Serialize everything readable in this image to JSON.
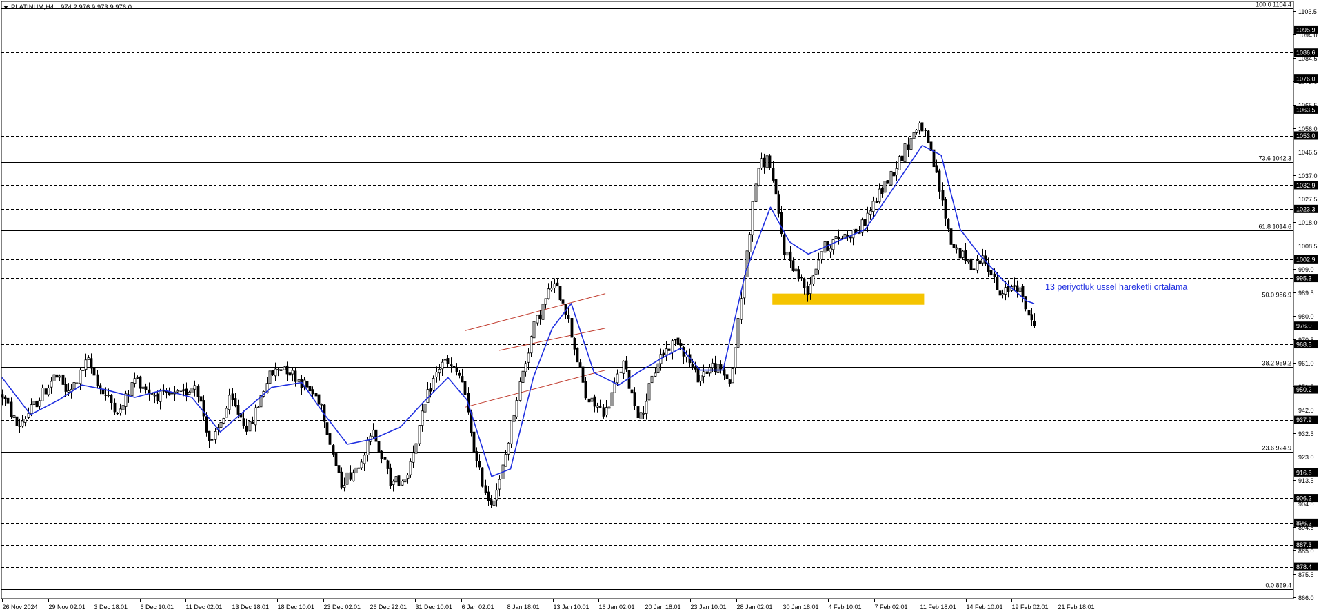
{
  "header": {
    "symbol_timeframe": "PLATINUM,H4",
    "ohlc": "974.2 976.9 973.9 976.0"
  },
  "annotation": {
    "ema_label": "13 periyotluk üssel hareketli ortalama"
  },
  "colors": {
    "background": "#ffffff",
    "candle": "#000000",
    "ema": "#1f2fe0",
    "channel": "#c0392b",
    "highlight": "#f5c400",
    "label_box": "#000000",
    "label_text": "#ffffff",
    "annotation_text": "#1f2fe0"
  },
  "chart_data": {
    "type": "candlestick",
    "title": "PLATINUM,H4",
    "ylim": [
      866.0,
      1107.0
    ],
    "yticks": [
      "1103.5",
      "1094.0",
      "1084.5",
      "1075.0",
      "1065.5",
      "1056.0",
      "1046.5",
      "1037.0",
      "1027.5",
      "1018.0",
      "1008.5",
      "999.0",
      "989.5",
      "980.0",
      "970.5",
      "961.0",
      "951.5",
      "942.0",
      "932.5",
      "923.0",
      "913.5",
      "904.0",
      "894.5",
      "885.0",
      "875.5",
      "866.0"
    ],
    "xticks": [
      "26 Nov 2024",
      "29 Nov 02:01",
      "3 Dec 18:01",
      "6 Dec 10:01",
      "11 Dec 02:01",
      "13 Dec 18:01",
      "18 Dec 10:01",
      "23 Dec 02:01",
      "26 Dec 22:01",
      "31 Dec 10:01",
      "6 Jan 02:01",
      "8 Jan 18:01",
      "13 Jan 10:01",
      "16 Jan 02:01",
      "20 Jan 18:01",
      "23 Jan 10:01",
      "28 Jan 02:01",
      "30 Jan 18:01",
      "4 Feb 10:01",
      "7 Feb 02:01",
      "11 Feb 18:01",
      "14 Feb 10:01",
      "19 Feb 02:01",
      "21 Feb 18:01"
    ],
    "n_bars": 360,
    "last_price": "976.0",
    "fib_levels": [
      {
        "label": "100.0 1104.4",
        "value": 1104.4
      },
      {
        "label": "73.6 1042.3",
        "value": 1042.3
      },
      {
        "label": "61.8 1014.6",
        "value": 1014.6
      },
      {
        "label": "50.0 986.9",
        "value": 986.9
      },
      {
        "label": "38.2 959.2",
        "value": 959.2
      },
      {
        "label": "23.6 924.9",
        "value": 924.9
      },
      {
        "label": "0.0 869.4",
        "value": 869.4
      }
    ],
    "dashed_levels": [
      {
        "label": "1095.9",
        "value": 1095.9
      },
      {
        "label": "1086.6",
        "value": 1086.6
      },
      {
        "label": "1076.0",
        "value": 1076.0
      },
      {
        "label": "1063.5",
        "value": 1063.5
      },
      {
        "label": "1053.0",
        "value": 1053.0
      },
      {
        "label": "1032.9",
        "value": 1032.9
      },
      {
        "label": "1023.3",
        "value": 1023.3
      },
      {
        "label": "1002.9",
        "value": 1002.9
      },
      {
        "label": "995.3",
        "value": 995.3
      },
      {
        "label": "968.5",
        "value": 968.5
      },
      {
        "label": "950.2",
        "value": 950.2
      },
      {
        "label": "937.9",
        "value": 937.9
      },
      {
        "label": "916.6",
        "value": 916.6
      },
      {
        "label": "906.2",
        "value": 906.2
      },
      {
        "label": "896.2",
        "value": 896.2
      },
      {
        "label": "887.3",
        "value": 887.3
      },
      {
        "label": "878.4",
        "value": 878.4
      }
    ],
    "price_path": [
      [
        0,
        948
      ],
      [
        8,
        935
      ],
      [
        18,
        945
      ],
      [
        28,
        956
      ],
      [
        35,
        948
      ],
      [
        45,
        962
      ],
      [
        52,
        950
      ],
      [
        62,
        941
      ],
      [
        70,
        955
      ],
      [
        78,
        949
      ],
      [
        85,
        947
      ],
      [
        95,
        948
      ],
      [
        102,
        953
      ],
      [
        110,
        927
      ],
      [
        120,
        946
      ],
      [
        130,
        934
      ],
      [
        140,
        955
      ],
      [
        148,
        960
      ],
      [
        158,
        953
      ],
      [
        168,
        945
      ],
      [
        178,
        912
      ],
      [
        186,
        918
      ],
      [
        196,
        933
      ],
      [
        205,
        912
      ],
      [
        213,
        915
      ],
      [
        225,
        950
      ],
      [
        232,
        962
      ],
      [
        242,
        955
      ],
      [
        250,
        920
      ],
      [
        257,
        904
      ],
      [
        262,
        912
      ],
      [
        272,
        950
      ],
      [
        280,
        975
      ],
      [
        290,
        993
      ],
      [
        296,
        986
      ],
      [
        308,
        946
      ],
      [
        318,
        941
      ],
      [
        327,
        961
      ],
      [
        336,
        938
      ],
      [
        346,
        963
      ],
      [
        356,
        971
      ],
      [
        366,
        955
      ],
      [
        375,
        960
      ],
      [
        384,
        953
      ],
      [
        398,
        1040
      ],
      [
        404,
        1044
      ],
      [
        412,
        1007
      ],
      [
        424,
        990
      ],
      [
        432,
        1007
      ],
      [
        442,
        1012
      ],
      [
        452,
        1015
      ],
      [
        462,
        1029
      ],
      [
        472,
        1042
      ],
      [
        484,
        1059
      ],
      [
        492,
        1038
      ],
      [
        500,
        1010
      ],
      [
        510,
        1000
      ],
      [
        518,
        1004
      ],
      [
        526,
        987
      ],
      [
        534,
        994
      ],
      [
        540,
        983
      ],
      [
        544,
        973
      ]
    ],
    "ema_path": [
      [
        0,
        955
      ],
      [
        15,
        940
      ],
      [
        30,
        946
      ],
      [
        42,
        952
      ],
      [
        55,
        950
      ],
      [
        70,
        947
      ],
      [
        85,
        950
      ],
      [
        100,
        947
      ],
      [
        115,
        933
      ],
      [
        130,
        943
      ],
      [
        142,
        951
      ],
      [
        158,
        953
      ],
      [
        170,
        940
      ],
      [
        182,
        928
      ],
      [
        195,
        930
      ],
      [
        210,
        935
      ],
      [
        222,
        945
      ],
      [
        235,
        955
      ],
      [
        245,
        946
      ],
      [
        258,
        915
      ],
      [
        268,
        918
      ],
      [
        280,
        955
      ],
      [
        290,
        975
      ],
      [
        300,
        985
      ],
      [
        312,
        957
      ],
      [
        325,
        952
      ],
      [
        335,
        957
      ],
      [
        348,
        963
      ],
      [
        358,
        967
      ],
      [
        368,
        958
      ],
      [
        380,
        958
      ],
      [
        392,
        998
      ],
      [
        405,
        1024
      ],
      [
        415,
        1010
      ],
      [
        425,
        1005
      ],
      [
        440,
        1010
      ],
      [
        455,
        1015
      ],
      [
        470,
        1032
      ],
      [
        485,
        1049
      ],
      [
        495,
        1045
      ],
      [
        505,
        1015
      ],
      [
        515,
        1005
      ],
      [
        528,
        994
      ],
      [
        540,
        986
      ],
      [
        544,
        985
      ]
    ],
    "x_domain": [
      0,
      544
    ],
    "channel": {
      "lines": [
        {
          "x0": 244,
          "y0": 943,
          "x1": 318,
          "y1": 958
        },
        {
          "x0": 244,
          "y0": 974,
          "x1": 318,
          "y1": 989
        },
        {
          "x0": 262,
          "y0": 966,
          "x1": 318,
          "y1": 975
        }
      ]
    },
    "highlight_zone": {
      "y_low": 984.5,
      "y_high": 989.0,
      "x_start": 406,
      "x_end": 486
    }
  }
}
